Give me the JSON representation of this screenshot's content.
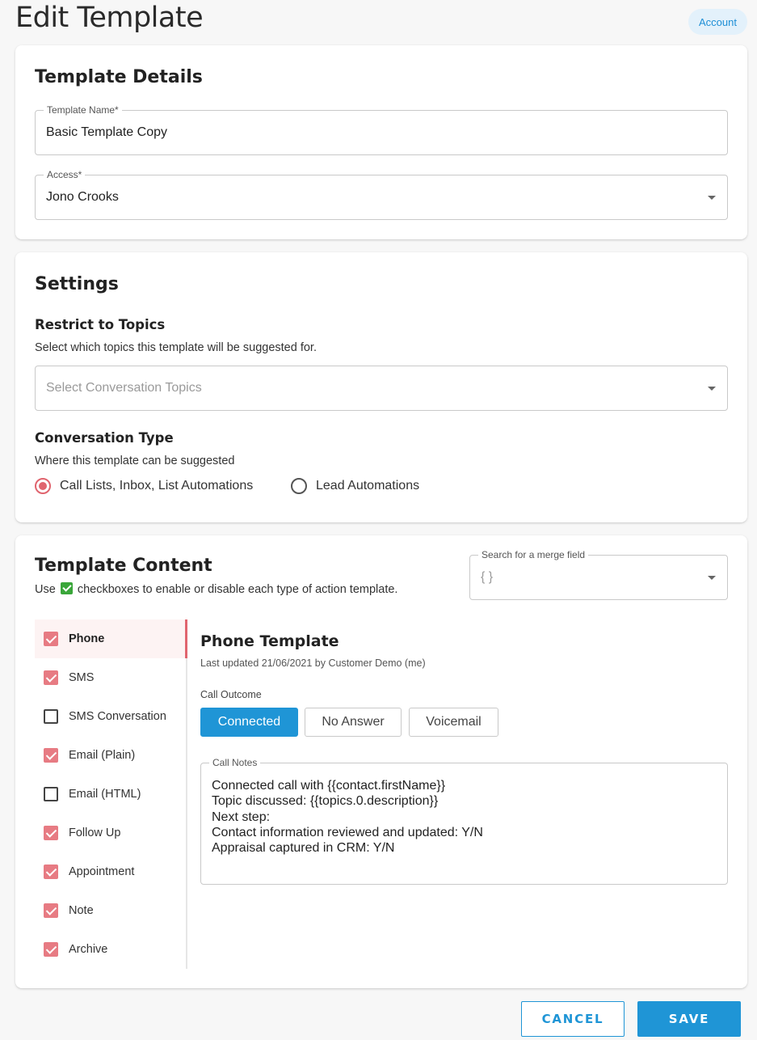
{
  "page": {
    "title": "Edit Template",
    "account_label": "Account"
  },
  "details": {
    "title": "Template Details",
    "name_label": "Template Name*",
    "name_value": "Basic Template Copy",
    "access_label": "Access*",
    "access_value": "Jono Crooks"
  },
  "settings": {
    "title": "Settings",
    "topics_heading": "Restrict to Topics",
    "topics_help": "Select which topics this template will be suggested for.",
    "topics_placeholder": "Select Conversation Topics",
    "type_heading": "Conversation Type",
    "type_help": "Where this template can be suggested",
    "type_options": [
      {
        "label": "Call Lists, Inbox, List Automations",
        "selected": true
      },
      {
        "label": "Lead Automations",
        "selected": false
      }
    ]
  },
  "content": {
    "title": "Template Content",
    "help_before": "Use",
    "help_after": "checkboxes to enable or disable each type of action template.",
    "merge_label": "Search for a merge field",
    "merge_placeholder": "{ }",
    "action_types": [
      {
        "label": "Phone",
        "checked": true,
        "active": true
      },
      {
        "label": "SMS",
        "checked": true,
        "active": false
      },
      {
        "label": "SMS Conversation",
        "checked": false,
        "active": false
      },
      {
        "label": "Email (Plain)",
        "checked": true,
        "active": false
      },
      {
        "label": "Email (HTML)",
        "checked": false,
        "active": false
      },
      {
        "label": "Follow Up",
        "checked": true,
        "active": false
      },
      {
        "label": "Appointment",
        "checked": true,
        "active": false
      },
      {
        "label": "Note",
        "checked": true,
        "active": false
      },
      {
        "label": "Archive",
        "checked": true,
        "active": false
      }
    ],
    "panel": {
      "title": "Phone Template",
      "updated": "Last updated 21/06/2021 by Customer Demo (me)",
      "outcome_label": "Call Outcome",
      "outcomes": [
        {
          "label": "Connected",
          "selected": true
        },
        {
          "label": "No Answer",
          "selected": false
        },
        {
          "label": "Voicemail",
          "selected": false
        }
      ],
      "notes_label": "Call Notes",
      "notes_value": "Connected call with {{contact.firstName}}\nTopic discussed: {{topics.0.description}}\nNext step:\nContact information reviewed and updated: Y/N\nAppraisal captured in CRM: Y/N"
    }
  },
  "footer": {
    "cancel_label": "CANCEL",
    "save_label": "SAVE"
  },
  "colors": {
    "accent": "#1f95d6",
    "checkbox": "#e77b83",
    "radio": "#e0646e",
    "active_bg": "#fdf3f3"
  }
}
